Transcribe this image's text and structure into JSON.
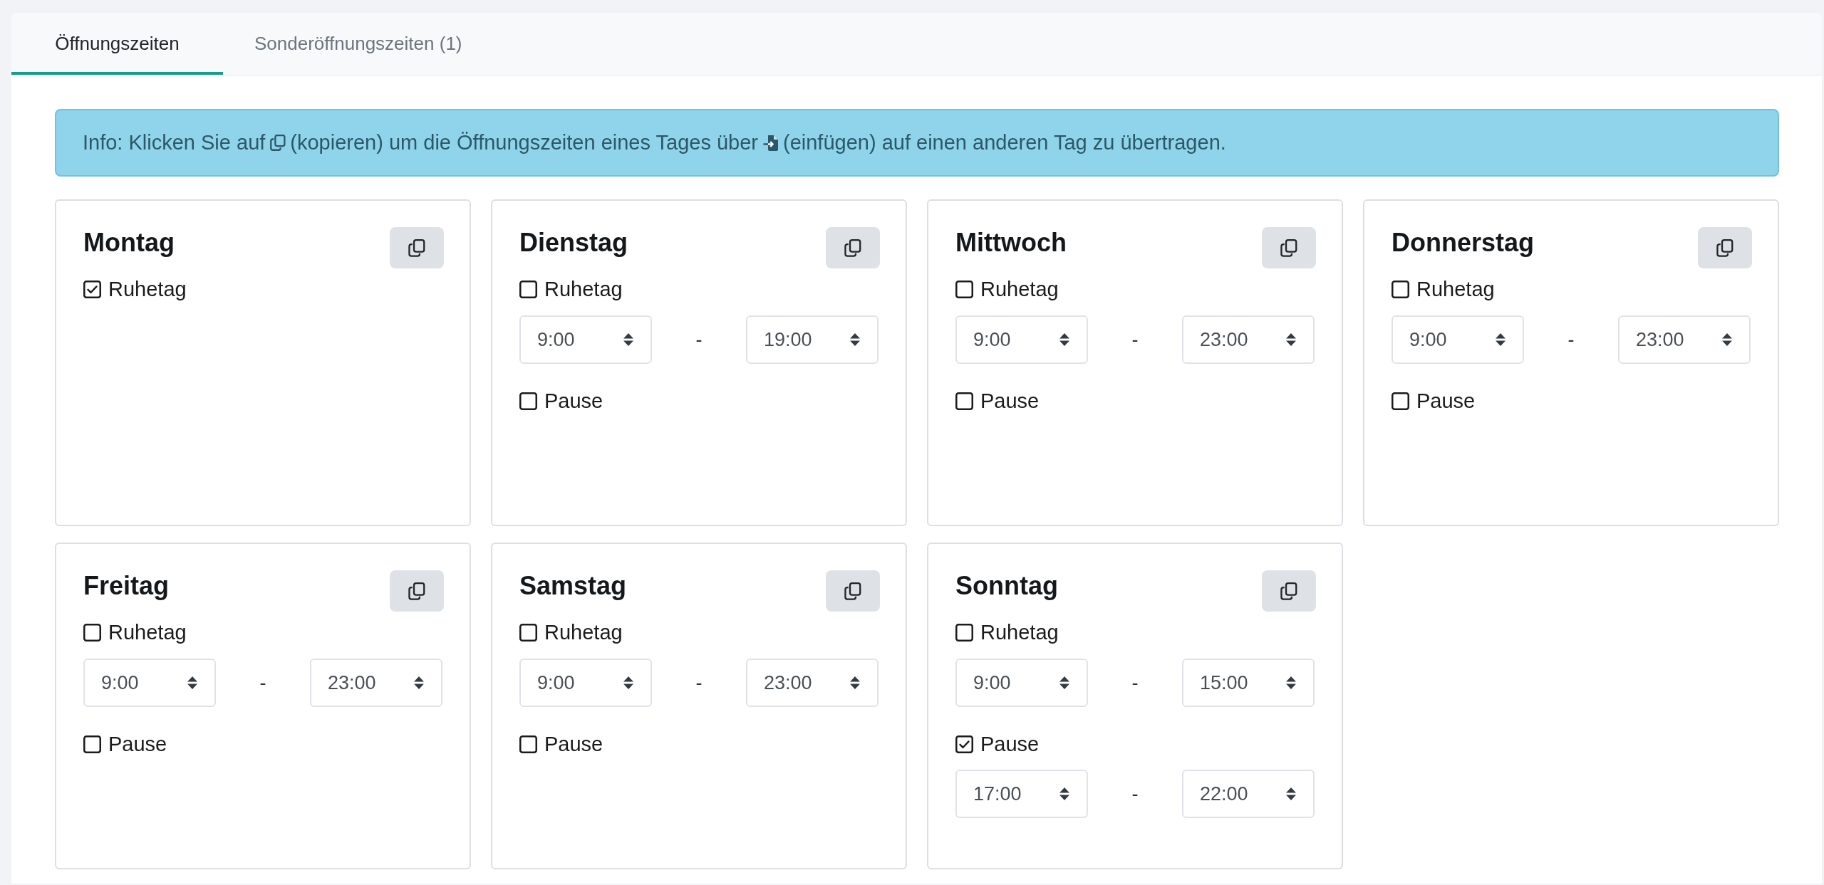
{
  "tabs": [
    {
      "label": "Öffnungszeiten",
      "selected": true
    },
    {
      "label": "Sonderöffnungszeiten (1)",
      "selected": false
    }
  ],
  "info": {
    "parts": [
      "Info: Klicken Sie auf",
      "(kopieren) um die Öffnungszeiten eines Tages über",
      "(einfügen) auf einen anderen Tag zu übertragen."
    ]
  },
  "days": [
    {
      "name": "Montag",
      "rest_day": {
        "label": "Ruhetag",
        "checked": true
      }
    },
    {
      "name": "Dienstag",
      "rest_day": {
        "label": "Ruhetag",
        "checked": false
      },
      "hours": {
        "from": "9:00",
        "separator": "-",
        "to": "19:00"
      },
      "pause": {
        "label": "Pause",
        "checked": false
      }
    },
    {
      "name": "Mittwoch",
      "rest_day": {
        "label": "Ruhetag",
        "checked": false
      },
      "hours": {
        "from": "9:00",
        "separator": "-",
        "to": "23:00"
      },
      "pause": {
        "label": "Pause",
        "checked": false
      }
    },
    {
      "name": "Donnerstag",
      "rest_day": {
        "label": "Ruhetag",
        "checked": false
      },
      "hours": {
        "from": "9:00",
        "separator": "-",
        "to": "23:00"
      },
      "pause": {
        "label": "Pause",
        "checked": false
      }
    },
    {
      "name": "Freitag",
      "rest_day": {
        "label": "Ruhetag",
        "checked": false
      },
      "hours": {
        "from": "9:00",
        "separator": "-",
        "to": "23:00"
      },
      "pause": {
        "label": "Pause",
        "checked": false
      }
    },
    {
      "name": "Samstag",
      "rest_day": {
        "label": "Ruhetag",
        "checked": false
      },
      "hours": {
        "from": "9:00",
        "separator": "-",
        "to": "23:00"
      },
      "pause": {
        "label": "Pause",
        "checked": false
      }
    },
    {
      "name": "Sonntag",
      "rest_day": {
        "label": "Ruhetag",
        "checked": false
      },
      "hours": {
        "from": "9:00",
        "separator": "-",
        "to": "15:00"
      },
      "pause": {
        "label": "Pause",
        "checked": true
      },
      "pause_hours": {
        "from": "17:00",
        "separator": "-",
        "to": "22:00"
      }
    }
  ]
}
